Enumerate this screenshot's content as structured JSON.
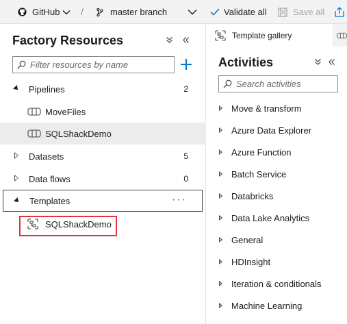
{
  "toolbar": {
    "repo_label": "GitHub",
    "branch_label": "master branch",
    "separator": "/",
    "validate_label": "Validate all",
    "save_label": "Save all"
  },
  "factory": {
    "title": "Factory Resources",
    "collapse_icon": "double-chevron-down-icon",
    "hide_icon": "double-chevron-left-icon",
    "search_placeholder": "Filter resources by name",
    "add_icon": "plus-icon",
    "groups": [
      {
        "label": "Pipelines",
        "count": "2",
        "expanded": true,
        "items": [
          {
            "label": "MoveFiles"
          },
          {
            "label": "SQLShackDemo",
            "selected": true
          }
        ]
      },
      {
        "label": "Datasets",
        "count": "5",
        "expanded": false
      },
      {
        "label": "Data flows",
        "count": "0",
        "expanded": false
      },
      {
        "label": "Templates",
        "count": "",
        "expanded": true,
        "more": "···",
        "items": [
          {
            "label": "SQLShackDemo",
            "highlighted": true
          }
        ]
      }
    ]
  },
  "tabs": [
    {
      "label": "Template gallery",
      "icon": "template-gallery-icon"
    }
  ],
  "activities": {
    "title": "Activities",
    "search_placeholder": "Search activities",
    "items": [
      "Move & transform",
      "Azure Data Explorer",
      "Azure Function",
      "Batch Service",
      "Databricks",
      "Data Lake Analytics",
      "General",
      "HDInsight",
      "Iteration & conditionals",
      "Machine Learning"
    ]
  },
  "colors": {
    "accent": "#0078d4",
    "highlight_border": "#e2343c",
    "selected_bg": "#ececec"
  }
}
